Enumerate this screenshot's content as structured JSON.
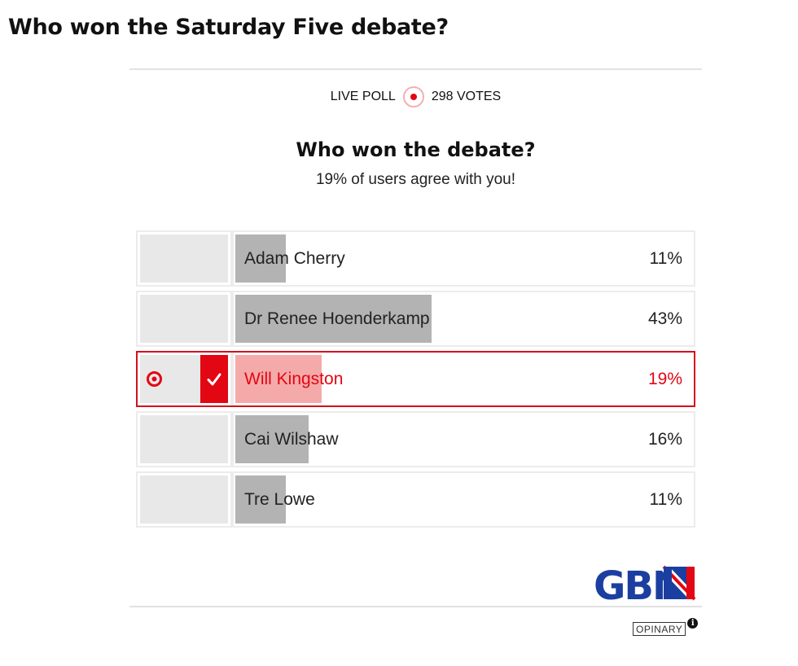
{
  "page": {
    "heading": "Who won the Saturday Five debate?"
  },
  "poll": {
    "status_label": "LIVE POLL",
    "votes_label": "298 VOTES",
    "question": "Who won the debate?",
    "agreement_text": "19% of users agree with you!",
    "options": [
      {
        "name": "Adam Cherry",
        "percent_label": "11%",
        "share": 0.11,
        "selected": false
      },
      {
        "name": "Dr Renee Hoenderkamp",
        "percent_label": "43%",
        "share": 0.43,
        "selected": false
      },
      {
        "name": "Will Kingston",
        "percent_label": "19%",
        "share": 0.19,
        "selected": true
      },
      {
        "name": "Cai Wilshaw",
        "percent_label": "16%",
        "share": 0.16,
        "selected": false
      },
      {
        "name": "Tre Lowe",
        "percent_label": "11%",
        "share": 0.11,
        "selected": false
      }
    ]
  },
  "branding": {
    "logo_text": "GBN",
    "powered_by": "OPINARY",
    "info_glyph": "i"
  },
  "colors": {
    "accent": "#e30613",
    "bar": "#b3b3b3",
    "bar_selected": "#f5aaaa",
    "logo_blue": "#1b3fa0"
  },
  "icons": {
    "live": "live-dot-icon",
    "selected": "checkmark-icon",
    "target": "target-icon",
    "info": "info-icon"
  }
}
